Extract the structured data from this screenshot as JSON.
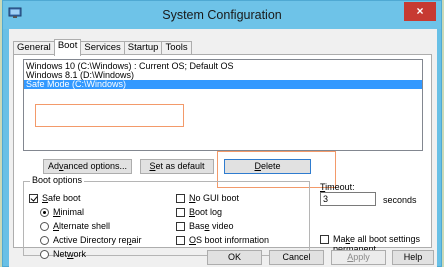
{
  "window": {
    "title": "System Configuration",
    "close_glyph": "×",
    "app_icon": "computer-icon"
  },
  "tabs": [
    "General",
    "Boot",
    "Services",
    "Startup",
    "Tools"
  ],
  "os_list": [
    "Windows 10 (C:\\Windows) : Current OS; Default OS",
    "Windows 8.1 (D:\\Windows)",
    "Safe Mode (C:\\Windows)"
  ],
  "buttons": {
    "advanced": {
      "pre": "Ad",
      "key": "v",
      "post": "anced options..."
    },
    "set_default": {
      "pre": "",
      "key": "S",
      "post": "et as default"
    },
    "delete": {
      "pre": "",
      "key": "D",
      "post": "elete"
    }
  },
  "boot_options": {
    "label": "Boot options",
    "safe_boot": {
      "pre": "",
      "key": "S",
      "post": "afe boot"
    },
    "minimal": {
      "pre": "",
      "key": "M",
      "post": "inimal"
    },
    "alternate_shell": {
      "pre": "",
      "key": "A",
      "post": "lternate shell"
    },
    "ad_repair": {
      "pre": "Active Directory re",
      "key": "p",
      "post": "air"
    },
    "network": {
      "pre": "Net",
      "key": "w",
      "post": "ork"
    },
    "no_gui": {
      "pre": "",
      "key": "N",
      "post": "o GUI boot"
    },
    "boot_log": {
      "pre": "",
      "key": "B",
      "post": "oot log"
    },
    "base_video": {
      "pre": "Bas",
      "key": "e",
      "post": " video"
    },
    "os_info": {
      "pre": "",
      "key": "O",
      "post": "S boot information"
    }
  },
  "timeout": {
    "label_key": "T",
    "label_post": "imeout:",
    "value": "3",
    "unit": "seconds"
  },
  "make_permanent": {
    "line1_pre": "Ma",
    "line1_key": "k",
    "line1_post": "e all boot settings",
    "line2": "permanent"
  },
  "footer": {
    "ok": "OK",
    "cancel": "Cancel",
    "apply_key": "A",
    "apply_post": "pply",
    "help": "Help"
  }
}
